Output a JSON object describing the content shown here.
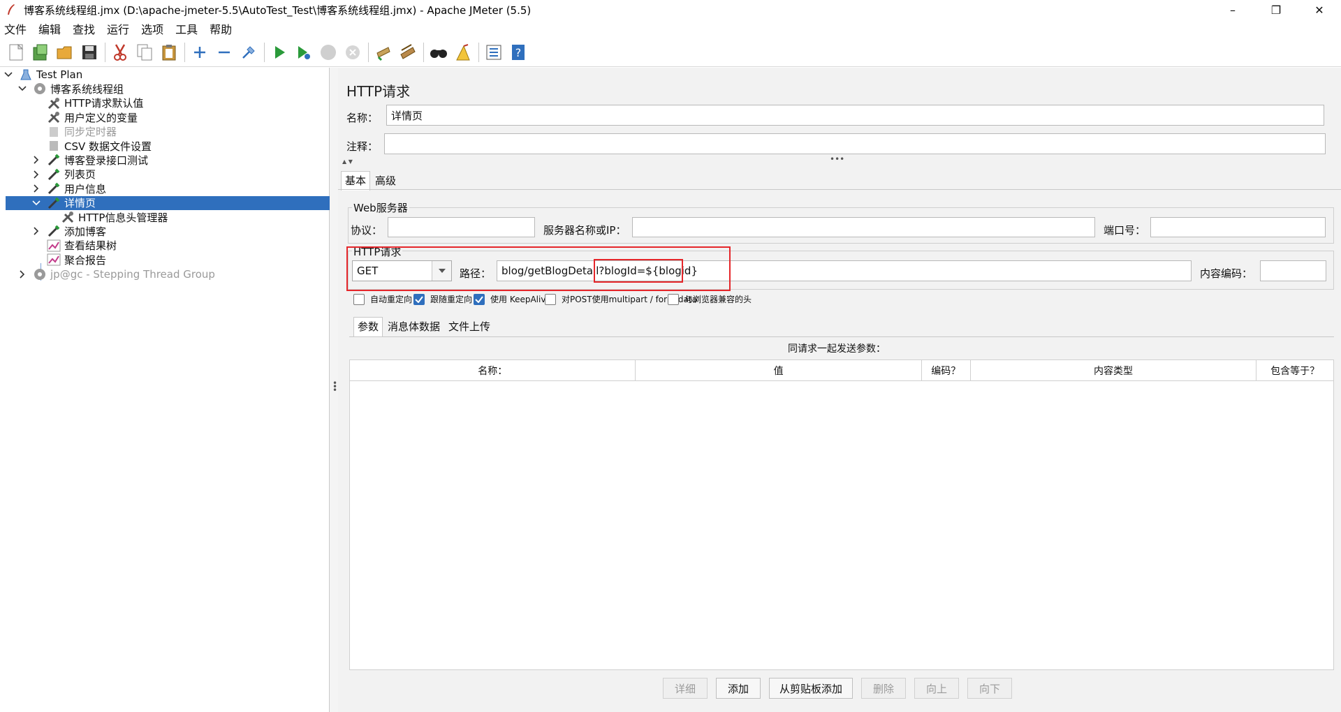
{
  "window": {
    "title": "博客系统线程组.jmx (D:\\apache-jmeter-5.5\\AutoTest_Test\\博客系统线程组.jmx) - Apache JMeter (5.5)",
    "controls": [
      "–",
      "❐",
      "✕"
    ]
  },
  "menu": [
    "文件",
    "编辑",
    "查找",
    "运行",
    "选项",
    "工具",
    "帮助"
  ],
  "toolbar": [
    "new-icon",
    "templates-icon",
    "open-icon",
    "save-icon",
    "cut-icon",
    "copy-icon",
    "paste-icon",
    "expand-icon",
    "collapse-icon",
    "toggle-icon",
    "start-icon",
    "start-no-pause-icon",
    "stop-icon",
    "shutdown-icon",
    "clear-icon",
    "clear-all-icon",
    "search-icon",
    "reset-search-icon",
    "function-helper-icon",
    "help-icon"
  ],
  "tree": [
    {
      "label": "Test Plan",
      "level": 0,
      "chevron": "down",
      "icon": "test-plan-icon"
    },
    {
      "label": "博客系统线程组",
      "level": 1,
      "chevron": "down",
      "icon": "thread-group-icon"
    },
    {
      "label": "HTTP请求默认值",
      "level": 2,
      "chevron": "",
      "icon": "config-tool-icon"
    },
    {
      "label": "用户定义的变量",
      "level": 2,
      "chevron": "",
      "icon": "config-tool-icon"
    },
    {
      "label": "同步定时器",
      "level": 2,
      "chevron": "",
      "icon": "timer-icon",
      "disabled": true
    },
    {
      "label": "CSV 数据文件设置",
      "level": 2,
      "chevron": "",
      "icon": "file-icon"
    },
    {
      "label": "博客登录接口测试",
      "level": 2,
      "chevron": "right",
      "icon": "sampler-icon"
    },
    {
      "label": "列表页",
      "level": 2,
      "chevron": "right",
      "icon": "sampler-icon"
    },
    {
      "label": "用户信息",
      "level": 2,
      "chevron": "right",
      "icon": "sampler-icon"
    },
    {
      "label": "详情页",
      "level": 2,
      "chevron": "down",
      "icon": "sampler-icon",
      "selected": true
    },
    {
      "label": "HTTP信息头管理器",
      "level": 3,
      "chevron": "",
      "icon": "config-tool-icon"
    },
    {
      "label": "添加博客",
      "level": 2,
      "chevron": "right",
      "icon": "sampler-icon"
    },
    {
      "label": "查看结果树",
      "level": 2,
      "chevron": "",
      "icon": "listener-icon"
    },
    {
      "label": "聚合报告",
      "level": 2,
      "chevron": "",
      "icon": "listener-icon"
    },
    {
      "label": "jp@gc - Stepping Thread Group",
      "level": 1,
      "chevron": "right",
      "icon": "thread-group-icon",
      "disabled": true
    }
  ],
  "panel": {
    "title": "HTTP请求",
    "name_label": "名称：",
    "name_value": "详情页",
    "comment_label": "注释：",
    "comment_value": "",
    "tabs": [
      "基本",
      "高级"
    ],
    "web_server": {
      "legend": "Web服务器",
      "protocol_label": "协议：",
      "protocol_value": "",
      "server_label": "服务器名称或IP：",
      "server_value": "",
      "port_label": "端口号：",
      "port_value": ""
    },
    "http_request": {
      "legend": "HTTP请求",
      "method": "GET",
      "path_label": "路径：",
      "path_prefix": "blog/getBlogDetail?",
      "path_param": "blogId=${blogid}",
      "encoding_label": "内容编码：",
      "encoding_value": ""
    },
    "checkboxes": [
      {
        "label": "自动重定向",
        "checked": false
      },
      {
        "label": "跟随重定向",
        "checked": true
      },
      {
        "label": "使用 KeepAlive",
        "checked": true
      },
      {
        "label": "对POST使用multipart / form-data",
        "checked": false
      },
      {
        "label": "与浏览器兼容的头",
        "checked": false
      }
    ],
    "sub_tabs": [
      "参数",
      "消息体数据",
      "文件上传"
    ],
    "params_caption": "同请求一起发送参数：",
    "columns": [
      "名称：",
      "值",
      "编码？",
      "内容类型",
      "包含等于？"
    ],
    "buttons": [
      {
        "label": "详细",
        "enabled": false
      },
      {
        "label": "添加",
        "enabled": true
      },
      {
        "label": "从剪贴板添加",
        "enabled": true
      },
      {
        "label": "删除",
        "enabled": false
      },
      {
        "label": "向上",
        "enabled": false
      },
      {
        "label": "向下",
        "enabled": false
      }
    ]
  }
}
